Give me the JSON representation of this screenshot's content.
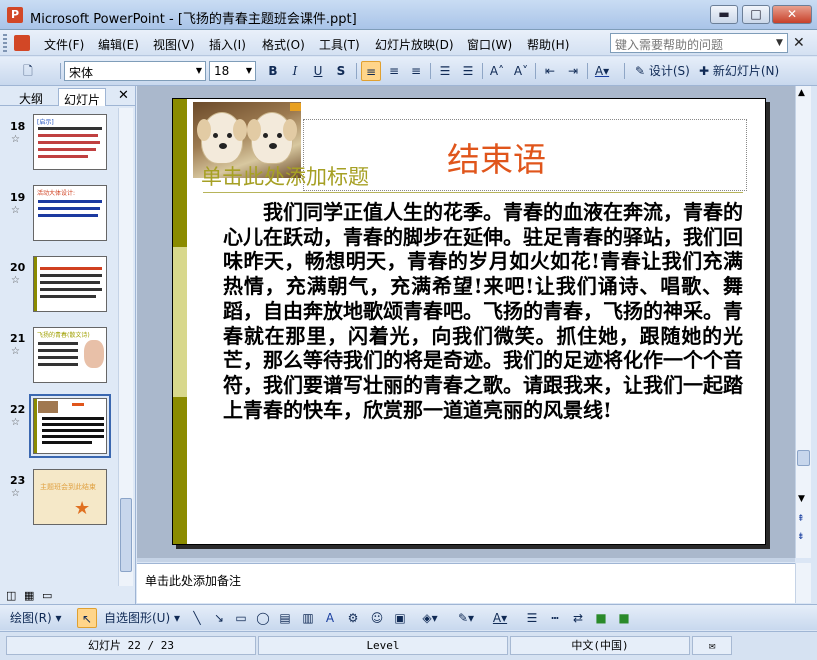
{
  "window": {
    "title": "Microsoft PowerPoint - [飞扬的青春主题班会课件.ppt]",
    "min": "▬",
    "max": "□",
    "close": "✕"
  },
  "menu": {
    "items": [
      "文件(F)",
      "编辑(E)",
      "视图(V)",
      "插入(I)",
      "格式(O)",
      "工具(T)",
      "幻灯片放映(D)",
      "窗口(W)",
      "帮助(H)"
    ],
    "help_placeholder": "键入需要帮助的问题",
    "close": "✕"
  },
  "toolbar": {
    "font": "宋体",
    "size": "18",
    "bold": "B",
    "italic": "I",
    "underline": "U",
    "shadow": "S",
    "design": "设计(S)",
    "new_slide": "新幻灯片(N)"
  },
  "left_panel": {
    "tabs": [
      "大纲",
      "幻灯片"
    ],
    "close": "✕",
    "thumbnails": [
      {
        "num": "18",
        "selected": false
      },
      {
        "num": "19",
        "selected": false
      },
      {
        "num": "20",
        "selected": false
      },
      {
        "num": "21",
        "selected": false
      },
      {
        "num": "22",
        "selected": true
      },
      {
        "num": "23",
        "selected": false
      }
    ],
    "thumb_texts": {
      "t18": "[启示]",
      "t19": "活动大体设计:",
      "t21": "飞扬的青春(散文诗)",
      "t23": "主题班会到此结束"
    }
  },
  "slide": {
    "title": "结束语",
    "ghost_title": "单击此处添加标题",
    "body": "我们同学正值人生的花季。青春的血液在奔流，青春的心儿在跃动，青春的脚步在延伸。驻足青春的驿站，我们回味昨天，畅想明天，青春的岁月如火如花!青春让我们充满热情，充满朝气，充满希望!来吧!让我们诵诗、唱歌、舞蹈，自由奔放地歌颂青春吧。飞扬的青春，飞扬的神采。青春就在那里，闪着光，向我们微笑。抓住她，跟随她的光芒，那么等待我们的将是奇迹。我们的足迹将化作一个个音符，我们要谱写壮丽的青春之歌。请跟我来，让我们一起踏上青春的快车，欣赏那一道道亮丽的风景线!"
  },
  "notes": {
    "placeholder": "单击此处添加备注"
  },
  "drawbar": {
    "draw": "绘图(R)",
    "autoshapes": "自选图形(U)"
  },
  "status": {
    "slide": "幻灯片 22 / 23",
    "design": "Level",
    "lang": "中文(中国)"
  }
}
